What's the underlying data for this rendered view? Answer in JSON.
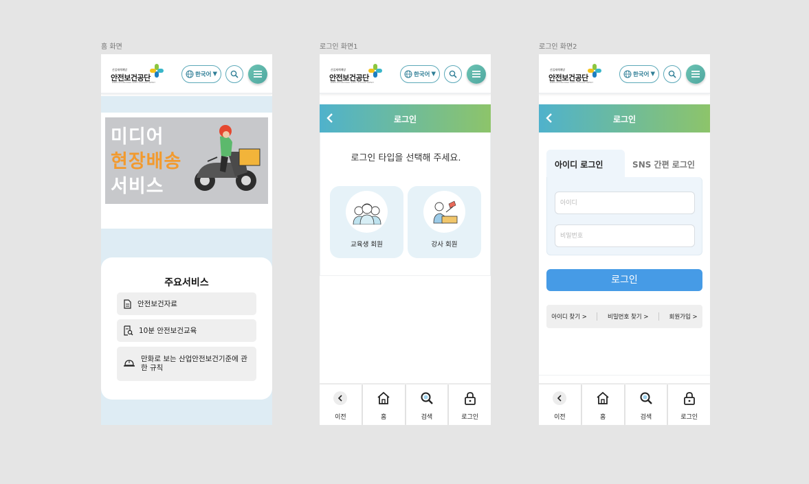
{
  "labels": {
    "home": "홈 화면",
    "login1": "로그인 화면1",
    "login2": "로그인 화면2"
  },
  "header": {
    "org_small": "산업재해예방",
    "org_name": "안전보건공단",
    "org_eng": "KOREA OCCUPATIONAL SAFETY & HEALTH AGENCY",
    "lang_label": "한국어",
    "icons": [
      "globe-icon",
      "search-icon",
      "hamburger-menu-icon"
    ]
  },
  "home": {
    "banner": {
      "line1": "미디어",
      "line2": "현장배송",
      "line3": "서비스"
    },
    "services_title": "주요서비스",
    "services": [
      {
        "label": "안전보건자료",
        "icon": "document-icon"
      },
      {
        "label": "10분 안전보건교육",
        "icon": "document-search-icon"
      },
      {
        "label": "만화로 보는 산업안전보건기준에 관한 규칙",
        "icon": "helmet-icon"
      }
    ]
  },
  "login1": {
    "title": "로그인",
    "prompt": "로그인 타입을 선택해 주세요.",
    "types": [
      {
        "label": "교육생 회원"
      },
      {
        "label": "강사 회원"
      }
    ]
  },
  "login2": {
    "title": "로그인",
    "tab_id": "아이디 로그인",
    "tab_sns": "SNS 간편 로그인",
    "id_placeholder": "아이디",
    "pw_placeholder": "비밀번호",
    "login_button": "로그인",
    "links": [
      "아이디 찾기 >",
      "비밀번호 찾기 >",
      "회원가입 >"
    ]
  },
  "nav": [
    {
      "label": "이전",
      "icon": "chevron-left-icon"
    },
    {
      "label": "홈",
      "icon": "home-icon"
    },
    {
      "label": "검색",
      "icon": "search-icon"
    },
    {
      "label": "로그인",
      "icon": "lock-icon"
    }
  ],
  "colors": {
    "accent": "#469be6",
    "bar_start": "#4fb2cc",
    "bar_end": "#8dc46a",
    "banner_orange": "#f29a2e"
  }
}
